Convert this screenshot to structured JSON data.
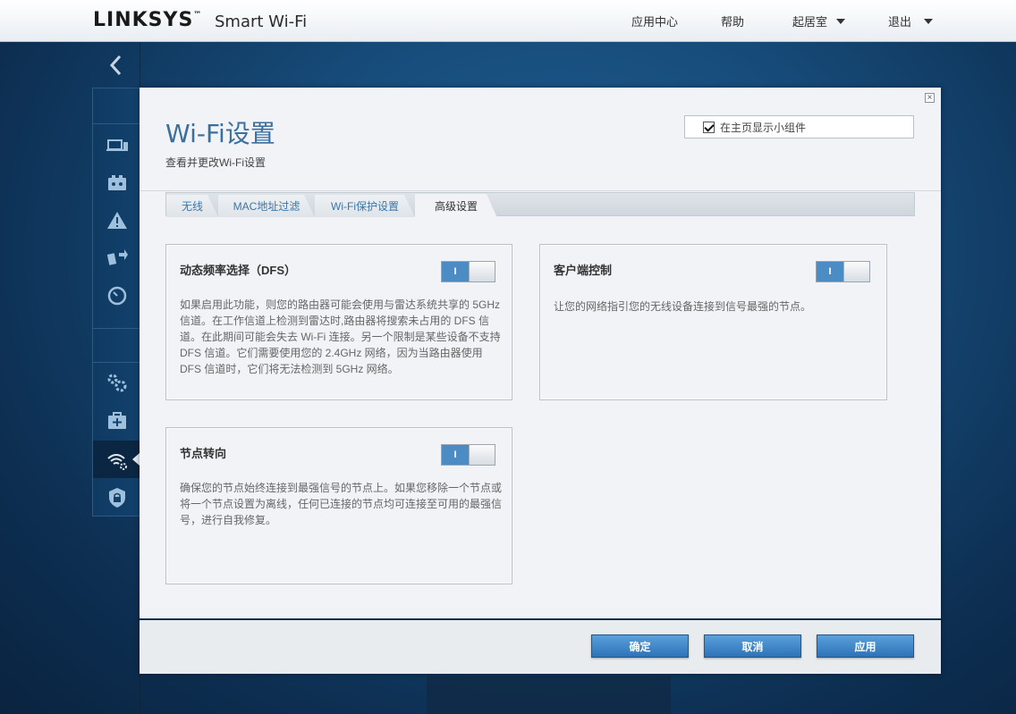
{
  "header": {
    "logo": "LINKSYS",
    "logo_tm": "™",
    "logo_sub": "Smart Wi-Fi",
    "nav": {
      "app_center": "应用中心",
      "help": "帮助",
      "location": "起居室",
      "logout": "退出"
    }
  },
  "panel": {
    "title": "Wi-Fi设置",
    "subtitle": "查看并更改Wi-Fi设置",
    "widget_checkbox_label": "在主页显示小组件",
    "close": "×",
    "tabs": [
      {
        "label": "无线"
      },
      {
        "label": "MAC地址过滤"
      },
      {
        "label": "Wi-Fi保护设置"
      },
      {
        "label": "高级设置"
      }
    ],
    "cards": {
      "dfs": {
        "title": "动态频率选择（DFS）",
        "toggle": "I",
        "description_lines": [
          "如果启用此功能，则您的路由器可能会使用与雷达系统共享的 5GHz",
          "信道。在工作信道上检测到雷达时,路由器将搜索未占用的 DFS 信",
          "道。在此期间可能会失去 Wi-Fi 连接。另一个限制是某些设备不支持",
          "DFS 信道。它们需要使用您的 2.4GHz 网络，因为当路由器使用",
          "DFS 信道时，它们将无法检测到 5GHz 网络。"
        ]
      },
      "client": {
        "title": "客户端控制",
        "toggle": "I",
        "description": "让您的网络指引您的无线设备连接到信号最强的节点。"
      },
      "node": {
        "title": "节点转向",
        "toggle": "I",
        "description_lines": [
          "确保您的节点始终连接到最强信号的节点上。如果您移除一个节点或",
          "将一个节点设置为离线，任何已连接的节点均可连接至可用的最强信",
          "号，进行自我修复。"
        ]
      }
    },
    "footer": {
      "ok": "确定",
      "cancel": "取消",
      "apply": "应用"
    }
  },
  "colors": {
    "accent": "#3b6f9e",
    "button": "#2e72b6",
    "toggle_on": "#4c8cc4",
    "background": "#174d7c"
  }
}
